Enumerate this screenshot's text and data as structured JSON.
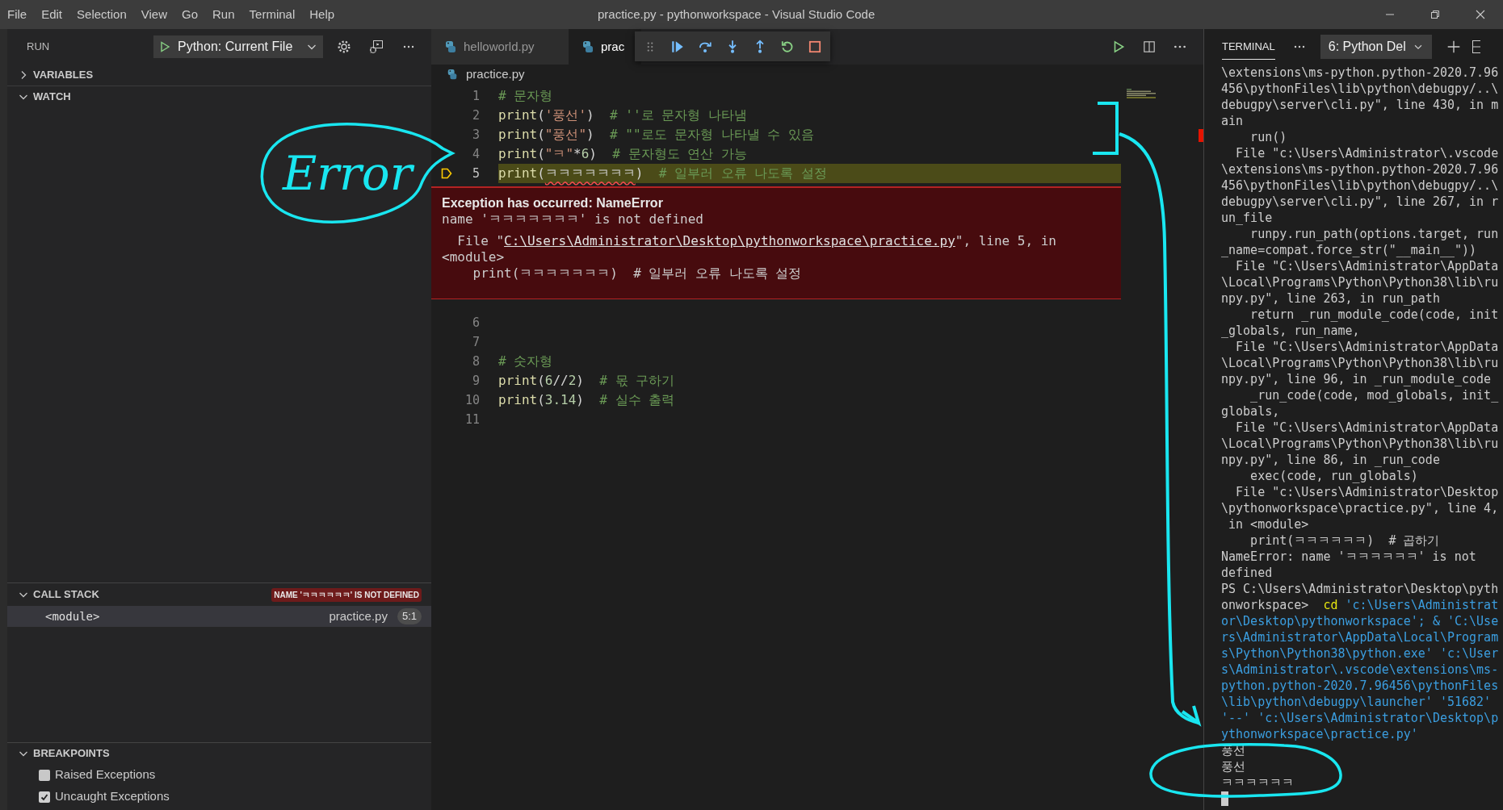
{
  "menu": [
    "File",
    "Edit",
    "Selection",
    "View",
    "Go",
    "Run",
    "Terminal",
    "Help"
  ],
  "window": {
    "title": "practice.py - pythonworkspace - Visual Studio Code",
    "controls": [
      {
        "kind": "minimize"
      },
      {
        "kind": "restore"
      },
      {
        "kind": "close"
      }
    ]
  },
  "sidebar": {
    "title": "RUN",
    "config": "Python: Current File",
    "sections": [
      {
        "kind": "variables",
        "title": "VARIABLES",
        "expanded": false
      },
      {
        "kind": "watch",
        "title": "WATCH",
        "expanded": true
      },
      {
        "kind": "callstack",
        "title": "CALL STACK",
        "expanded": true,
        "badge": "NAME 'ㅋㅋㅋㅋㅋㅋ' IS NOT DEFINED",
        "frames": [
          {
            "name": "<module>",
            "file": "practice.py",
            "position": "5:1",
            "selected": true
          }
        ]
      },
      {
        "kind": "breakpoints",
        "title": "BREAKPOINTS",
        "expanded": true,
        "items": [
          {
            "label": "Raised Exceptions",
            "checked": false
          },
          {
            "label": "Uncaught Exceptions",
            "checked": true
          }
        ]
      }
    ]
  },
  "editor": {
    "tabs": [
      {
        "label": "helloworld.py",
        "selected": false
      },
      {
        "label": "prac",
        "selected": true
      }
    ],
    "debug_toolbar": [
      {
        "kind": "grip"
      },
      {
        "kind": "continue"
      },
      {
        "kind": "step-over"
      },
      {
        "kind": "step-into"
      },
      {
        "kind": "step-out"
      },
      {
        "kind": "restart"
      },
      {
        "kind": "stop"
      }
    ],
    "actions": [
      {
        "kind": "run"
      },
      {
        "kind": "split"
      },
      {
        "kind": "more"
      }
    ],
    "breadcrumb": "practice.py",
    "lines": [
      {
        "number": "1",
        "current": false,
        "segments": [
          {
            "kind": "comment",
            "text": "# 문자형"
          }
        ]
      },
      {
        "number": "2",
        "current": false,
        "segments": [
          {
            "kind": "fn",
            "text": "print"
          },
          {
            "kind": "punc",
            "text": "("
          },
          {
            "kind": "str",
            "text": "'풍선'"
          },
          {
            "kind": "punc",
            "text": ")  "
          },
          {
            "kind": "comment",
            "text": "# ''로 문자형 나타냄"
          }
        ]
      },
      {
        "number": "3",
        "current": false,
        "segments": [
          {
            "kind": "fn",
            "text": "print"
          },
          {
            "kind": "punc",
            "text": "("
          },
          {
            "kind": "str",
            "text": "\"풍선\""
          },
          {
            "kind": "punc",
            "text": ")  "
          },
          {
            "kind": "comment",
            "text": "# \"\"로도 문자형 나타낼 수 있음"
          }
        ]
      },
      {
        "number": "4",
        "current": false,
        "segments": [
          {
            "kind": "fn",
            "text": "print"
          },
          {
            "kind": "punc",
            "text": "("
          },
          {
            "kind": "str",
            "text": "\"ㅋ\""
          },
          {
            "kind": "punc",
            "text": "*"
          },
          {
            "kind": "num",
            "text": "6"
          },
          {
            "kind": "punc",
            "text": ")  "
          },
          {
            "kind": "comment",
            "text": "# 문자형도 연산 가능"
          }
        ]
      },
      {
        "number": "5",
        "current": true,
        "segments": [
          {
            "kind": "fn",
            "text": "print"
          },
          {
            "kind": "punc",
            "text": "("
          },
          {
            "kind": "error",
            "text": "ㅋㅋㅋㅋㅋㅋㅋ"
          },
          {
            "kind": "punc",
            "text": ")  "
          },
          {
            "kind": "comment",
            "text": "# 일부러 오류 나도록 설정"
          }
        ]
      },
      {
        "number": "6",
        "current": false
      },
      {
        "number": "7",
        "current": false
      },
      {
        "number": "8",
        "current": false,
        "segments": [
          {
            "kind": "comment",
            "text": "# 숫자형"
          }
        ]
      },
      {
        "number": "9",
        "current": false,
        "segments": [
          {
            "kind": "fn",
            "text": "print"
          },
          {
            "kind": "punc",
            "text": "("
          },
          {
            "kind": "num",
            "text": "6"
          },
          {
            "kind": "punc",
            "text": "//"
          },
          {
            "kind": "num",
            "text": "2"
          },
          {
            "kind": "punc",
            "text": ")  "
          },
          {
            "kind": "comment",
            "text": "# 몫 구하기"
          }
        ]
      },
      {
        "number": "10",
        "current": false,
        "segments": [
          {
            "kind": "fn",
            "text": "print"
          },
          {
            "kind": "punc",
            "text": "("
          },
          {
            "kind": "num",
            "text": "3.14"
          },
          {
            "kind": "punc",
            "text": ")  "
          },
          {
            "kind": "comment",
            "text": "# 실수 출력"
          }
        ]
      },
      {
        "number": "11",
        "current": false
      }
    ],
    "exception": {
      "title": "Exception has occurred: NameError",
      "message": "name 'ㅋㅋㅋㅋㅋㅋㅋ' is not defined",
      "trace": [
        {
          "kind": "link",
          "before": "  File \"",
          "link": "C:\\Users\\Administrator\\Desktop\\pythonworkspace\\practice.py",
          "after": "\", line 5, in"
        },
        {
          "kind": "plain",
          "text": "<module>"
        },
        {
          "kind": "plain",
          "text": "    print(ㅋㅋㅋㅋㅋㅋㅋ)  # 일부러 오류 나도록 설정"
        }
      ]
    }
  },
  "terminal": {
    "tab": "TERMINAL",
    "selected_terminal": "6: Python Del",
    "cursor_visible": true,
    "rows": [
      {
        "kind": "output",
        "text": "\\extensions\\ms-python.python-2020.7.96"
      },
      {
        "kind": "output",
        "text": "456\\pythonFiles\\lib\\python\\debugpy/..\\"
      },
      {
        "kind": "output",
        "text": "debugpy\\server\\cli.py\", line 430, in m"
      },
      {
        "kind": "output",
        "text": "ain"
      },
      {
        "kind": "output",
        "text": "    run()"
      },
      {
        "kind": "output",
        "text": "  File \"c:\\Users\\Administrator\\.vscode"
      },
      {
        "kind": "output",
        "text": "\\extensions\\ms-python.python-2020.7.96"
      },
      {
        "kind": "output",
        "text": "456\\pythonFiles\\lib\\python\\debugpy/..\\"
      },
      {
        "kind": "output",
        "text": "debugpy\\server\\cli.py\", line 267, in r"
      },
      {
        "kind": "output",
        "text": "un_file"
      },
      {
        "kind": "output",
        "text": "    runpy.run_path(options.target, run"
      },
      {
        "kind": "output",
        "text": "_name=compat.force_str(\"__main__\"))"
      },
      {
        "kind": "output",
        "text": "  File \"C:\\Users\\Administrator\\AppData"
      },
      {
        "kind": "output",
        "text": "\\Local\\Programs\\Python\\Python38\\lib\\ru"
      },
      {
        "kind": "output",
        "text": "npy.py\", line 263, in run_path"
      },
      {
        "kind": "output",
        "text": "    return _run_module_code(code, init"
      },
      {
        "kind": "output",
        "text": "_globals, run_name,"
      },
      {
        "kind": "output",
        "text": "  File \"C:\\Users\\Administrator\\AppData"
      },
      {
        "kind": "output",
        "text": "\\Local\\Programs\\Python\\Python38\\lib\\ru"
      },
      {
        "kind": "output",
        "text": "npy.py\", line 96, in _run_module_code"
      },
      {
        "kind": "output",
        "text": "    _run_code(code, mod_globals, init_"
      },
      {
        "kind": "output",
        "text": "globals,"
      },
      {
        "kind": "output",
        "text": "  File \"C:\\Users\\Administrator\\AppData"
      },
      {
        "kind": "output",
        "text": "\\Local\\Programs\\Python\\Python38\\lib\\ru"
      },
      {
        "kind": "output",
        "text": "npy.py\", line 86, in _run_code"
      },
      {
        "kind": "output",
        "text": "    exec(code, run_globals)"
      },
      {
        "kind": "output",
        "text": "  File \"c:\\Users\\Administrator\\Desktop"
      },
      {
        "kind": "output",
        "text": "\\pythonworkspace\\practice.py\", line 4,"
      },
      {
        "kind": "output",
        "text": " in <module>"
      },
      {
        "kind": "output",
        "text": "    print(ㅋㅋㅋㅋㅋㅋ)  # 곱하기"
      },
      {
        "kind": "output",
        "text": "NameError: name 'ㅋㅋㅋㅋㅋㅋ' is not"
      },
      {
        "kind": "output",
        "text": "defined"
      },
      {
        "kind": "output",
        "text": "PS C:\\Users\\Administrator\\Desktop\\pyth"
      },
      {
        "kind": "mixed",
        "segments": [
          {
            "kind": "output",
            "text": "onworkspace>  "
          },
          {
            "kind": "keyword",
            "text": "cd"
          },
          {
            "kind": "command",
            "text": " 'c:\\Users\\Administrat"
          }
        ]
      },
      {
        "kind": "command",
        "text": "or\\Desktop\\pythonworkspace'; & 'C:\\Use"
      },
      {
        "kind": "command",
        "text": "rs\\Administrator\\AppData\\Local\\Program"
      },
      {
        "kind": "command",
        "text": "s\\Python\\Python38\\python.exe' 'c:\\User"
      },
      {
        "kind": "command",
        "text": "s\\Administrator\\.vscode\\extensions\\ms-"
      },
      {
        "kind": "command",
        "text": "python.python-2020.7.96456\\pythonFiles"
      },
      {
        "kind": "command",
        "text": "\\lib\\python\\debugpy\\launcher' '51682'"
      },
      {
        "kind": "command",
        "text": "'--' 'c:\\Users\\Administrator\\Desktop\\p"
      },
      {
        "kind": "command",
        "text": "ythonworkspace\\practice.py'"
      },
      {
        "kind": "output",
        "text": "풍선"
      },
      {
        "kind": "output",
        "text": "풍선"
      },
      {
        "kind": "output",
        "text": "ㅋㅋㅋㅋㅋㅋ"
      }
    ]
  },
  "annotation": {
    "label": "Error"
  }
}
